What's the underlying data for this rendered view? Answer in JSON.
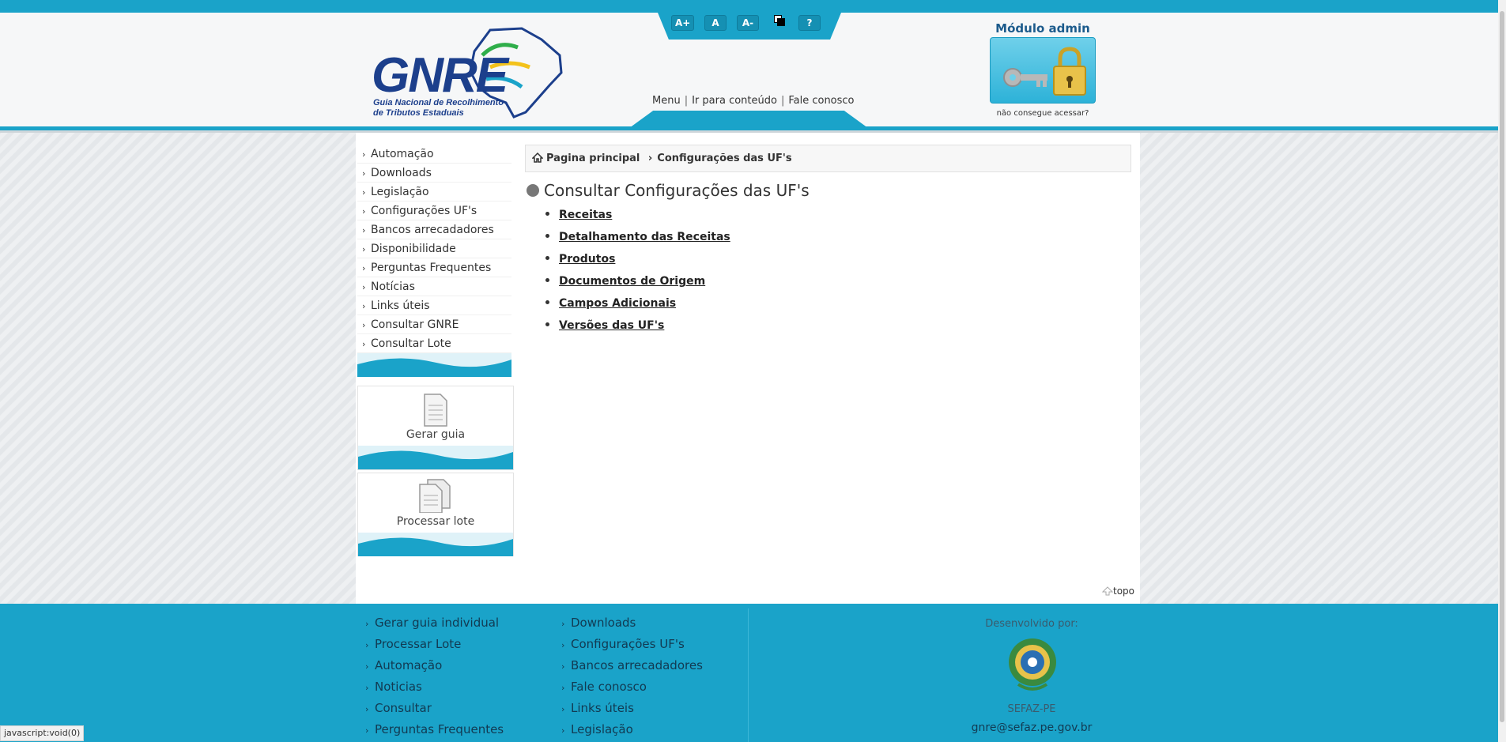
{
  "accessibility": {
    "increase_font": "A+",
    "normal_font": "A",
    "decrease_font": "A-",
    "help": "?"
  },
  "logo": {
    "text": "GNRE",
    "subtitle_line1": "Guia Nacional de Recolhimento",
    "subtitle_line2": "de Tributos Estaduais"
  },
  "header_links": {
    "menu": "Menu",
    "skip_to_content": "Ir para conteúdo",
    "contact": "Fale conosco"
  },
  "admin": {
    "title": "Módulo admin",
    "cant_access": "não consegue acessar?"
  },
  "sidebar": {
    "items": [
      {
        "label": "Automação"
      },
      {
        "label": "Downloads"
      },
      {
        "label": "Legislação"
      },
      {
        "label": "Configurações UF's"
      },
      {
        "label": "Bancos arrecadadores"
      },
      {
        "label": "Disponibilidade"
      },
      {
        "label": "Perguntas Frequentes"
      },
      {
        "label": "Notícias"
      },
      {
        "label": "Links úteis"
      },
      {
        "label": "Consultar GNRE"
      },
      {
        "label": "Consultar Lote"
      }
    ],
    "generate_guide": "Gerar guia",
    "process_batch": "Processar lote"
  },
  "breadcrumb": {
    "home": "Pagina principal",
    "current": "Configurações das UF's"
  },
  "main": {
    "title": "Consultar Configurações das UF's",
    "links": [
      {
        "label": "Receitas"
      },
      {
        "label": "Detalhamento das Receitas"
      },
      {
        "label": "Produtos"
      },
      {
        "label": "Documentos de Origem"
      },
      {
        "label": "Campos Adicionais"
      },
      {
        "label": "Versões das UF's"
      }
    ],
    "back_to_top": "topo"
  },
  "footer": {
    "col1": [
      {
        "label": "Gerar guia individual"
      },
      {
        "label": "Processar Lote"
      },
      {
        "label": "Automação"
      },
      {
        "label": "Noticias"
      },
      {
        "label": "Consultar"
      },
      {
        "label": "Perguntas Frequentes"
      }
    ],
    "col2": [
      {
        "label": "Downloads"
      },
      {
        "label": "Configurações UF's"
      },
      {
        "label": "Bancos arrecadadores"
      },
      {
        "label": "Fale conosco"
      },
      {
        "label": "Links úteis"
      },
      {
        "label": "Legislação"
      }
    ],
    "developed_by": "Desenvolvido por:",
    "org": "SEFAZ-PE",
    "email": "gnre@sefaz.pe.gov.br"
  },
  "status_bar": {
    "text": "javascript:void(0)"
  },
  "colors": {
    "accent": "#1aa3c9",
    "brand_blue": "#1c3f8c"
  }
}
